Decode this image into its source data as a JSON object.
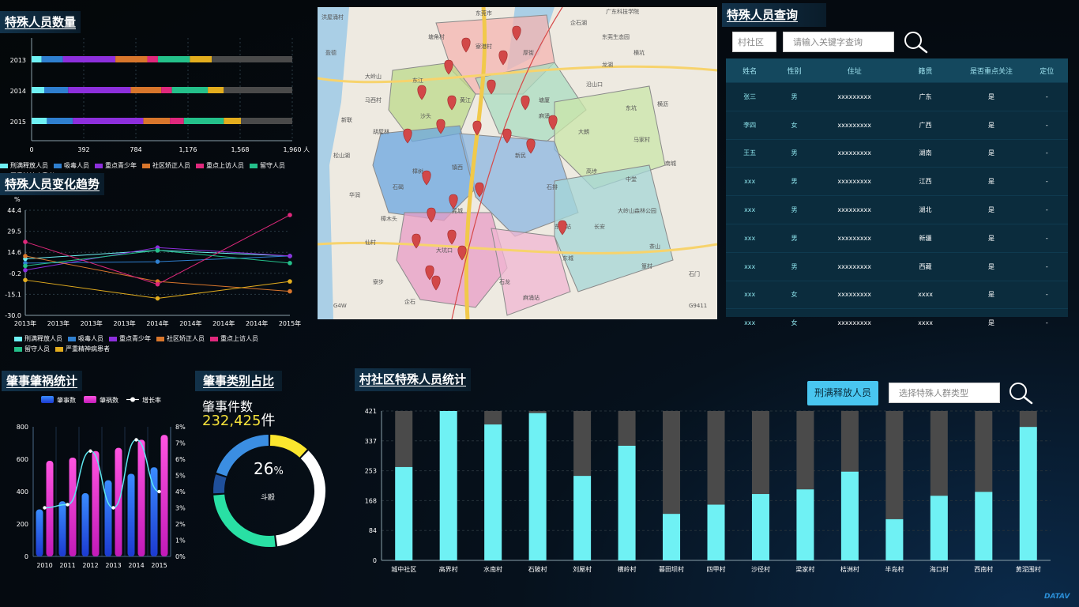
{
  "titles": {
    "count": "特殊人员数量",
    "trend": "特殊人员变化趋势",
    "query": "特殊人员查询",
    "accident": "肇事肇祸统计",
    "category": "肇事类别占比",
    "community": "村社区特殊人员统计"
  },
  "colors": {
    "cyan": "#6ff1f4",
    "blue": "#2f7fcf",
    "purple": "#8d2fdc",
    "orange": "#d8762c",
    "magenta": "#e0287c",
    "green": "#24c08a",
    "yellow": "#e3ad1e",
    "gray": "#4a4a4a"
  },
  "count_chart": {
    "categories": [
      "2013",
      "2014",
      "2015"
    ],
    "xticks": [
      "0",
      "392",
      "784",
      "1,176",
      "1,568",
      "1,960"
    ],
    "xunit": "人",
    "xlim": [
      0,
      1960
    ],
    "series": [
      {
        "name": "刑满释放人员",
        "values": [
          75,
          95,
          115
        ]
      },
      {
        "name": "吸毒人员",
        "values": [
          160,
          180,
          195
        ]
      },
      {
        "name": "重点青少年",
        "values": [
          395,
          470,
          530
        ]
      },
      {
        "name": "社区矫正人员",
        "values": [
          240,
          230,
          200
        ]
      },
      {
        "name": "重点上访人员",
        "values": [
          80,
          80,
          105
        ]
      },
      {
        "name": "留守人员",
        "values": [
          240,
          270,
          300
        ]
      },
      {
        "name": "严重精神病患者",
        "values": [
          165,
          120,
          130
        ]
      }
    ]
  },
  "trend_chart": {
    "unit": "%",
    "yticks": [
      "44.4",
      "29.5",
      "14.6",
      "-0.2",
      "-15.1",
      "-30.0"
    ],
    "ylim": [
      -30,
      44.4
    ],
    "xticks": [
      "2013年",
      "2013年",
      "2013年",
      "2013年",
      "2014年",
      "2014年",
      "2014年",
      "2014年",
      "2015年"
    ],
    "series": [
      {
        "name": "刑满释放人员",
        "points": [
          [
            0,
            10
          ],
          [
            4,
            16
          ],
          [
            8,
            12
          ]
        ]
      },
      {
        "name": "吸毒人员",
        "points": [
          [
            0,
            7
          ],
          [
            4,
            8
          ],
          [
            8,
            12
          ]
        ]
      },
      {
        "name": "重点青少年",
        "points": [
          [
            0,
            2
          ],
          [
            4,
            18
          ],
          [
            8,
            12
          ]
        ]
      },
      {
        "name": "社区矫正人员",
        "points": [
          [
            0,
            12
          ],
          [
            4,
            -6
          ],
          [
            8,
            -13
          ]
        ]
      },
      {
        "name": "重点上访人员",
        "points": [
          [
            0,
            22
          ],
          [
            4,
            -8
          ],
          [
            8,
            41
          ]
        ]
      },
      {
        "name": "留守人员",
        "points": [
          [
            0,
            5
          ],
          [
            4,
            16
          ],
          [
            8,
            7
          ]
        ]
      },
      {
        "name": "严重精神病患者",
        "points": [
          [
            0,
            -5
          ],
          [
            4,
            -18
          ],
          [
            8,
            -6
          ]
        ]
      }
    ]
  },
  "query": {
    "village_placeholder": "村社区",
    "keyword_placeholder": "请输入关键字查询",
    "columns": [
      "姓名",
      "性别",
      "住址",
      "籍贯",
      "是否重点关注",
      "定位"
    ],
    "rows": [
      [
        "张三",
        "男",
        "xxxxxxxxx",
        "广东",
        "是",
        "-"
      ],
      [
        "李四",
        "女",
        "xxxxxxxxx",
        "广西",
        "是",
        "-"
      ],
      [
        "王五",
        "男",
        "xxxxxxxxx",
        "湖南",
        "是",
        "-"
      ],
      [
        "xxx",
        "男",
        "xxxxxxxxx",
        "江西",
        "是",
        "-"
      ],
      [
        "xxx",
        "男",
        "xxxxxxxxx",
        "湖北",
        "是",
        "-"
      ],
      [
        "xxx",
        "男",
        "xxxxxxxxx",
        "新疆",
        "是",
        "-"
      ],
      [
        "xxx",
        "男",
        "xxxxxxxxx",
        "西藏",
        "是",
        "-"
      ],
      [
        "xxx",
        "女",
        "xxxxxxxxx",
        "xxxx",
        "是",
        "-"
      ],
      [
        "xxx",
        "女",
        "xxxxxxxxx",
        "xxxx",
        "是",
        "-"
      ]
    ]
  },
  "map": {
    "labels": [
      "洪屋涌村",
      "东莞市",
      "广东科技学院",
      "东莞生态园",
      "企石湖",
      "龙湖",
      "寮港村",
      "沿山口",
      "东坑",
      "横沥",
      "新民",
      "马家村",
      "盈德",
      "东江",
      "马西村",
      "新联",
      "胡屋林",
      "沙头",
      "麻涌",
      "高埗",
      "中堂",
      "石碣",
      "华润",
      "石排",
      "大岭山森林公园",
      "篁村",
      "莞城",
      "樟木头",
      "仙村",
      "大坑口",
      "石龙",
      "东城",
      "寮步",
      "企石",
      "麻涌站",
      "茶山",
      "石门",
      "松山湖",
      "镇西",
      "塘厦",
      "南城",
      "东城站",
      "长安",
      "樟树",
      "黄江",
      "大朗",
      "厚街",
      "横坑",
      "大岭山",
      "塘角村",
      "G9411",
      "G4W"
    ],
    "pins": 24
  },
  "accident": {
    "legend": [
      "肇事数",
      "肇祸数",
      "增长率"
    ],
    "years": [
      "2010",
      "2011",
      "2012",
      "2013",
      "2014",
      "2015"
    ],
    "incidents": [
      290,
      340,
      390,
      470,
      510,
      550
    ],
    "disasters": [
      590,
      610,
      650,
      670,
      720,
      750
    ],
    "growth_pct": [
      3.0,
      3.2,
      6.5,
      3.0,
      7.2,
      4.0
    ],
    "ylim": [
      0,
      800
    ],
    "y2lim_pct": [
      0,
      8
    ],
    "yticks": [
      "800",
      "600",
      "400",
      "200",
      "0"
    ],
    "y2ticks": [
      "8%",
      "7%",
      "6%",
      "5%",
      "4%",
      "3%",
      "2%",
      "1%",
      "0%"
    ]
  },
  "category": {
    "label": "肇事件数",
    "count": "232,425",
    "count_unit": "件",
    "percent": "26",
    "percent_sign": "%",
    "center_label": "斗殴",
    "segments": [
      {
        "name": "yellow",
        "value": 12,
        "color": "#fbe62e"
      },
      {
        "name": "white",
        "value": 36,
        "color": "#ffffff"
      },
      {
        "name": "green",
        "value": 26,
        "color": "#29e0a4"
      },
      {
        "name": "darkblue",
        "value": 6,
        "color": "#1f4f9a"
      },
      {
        "name": "blue",
        "value": 20,
        "color": "#3b8ee2"
      }
    ]
  },
  "community": {
    "type_button": "刑满释放人员",
    "type_placeholder": "选择特殊人群类型",
    "yticks": [
      "421",
      "337",
      "253",
      "168",
      "84",
      "0"
    ],
    "ylim": [
      0,
      421
    ],
    "categories": [
      "城中社区",
      "高界村",
      "水南村",
      "石陂村",
      "刘屋村",
      "横岭村",
      "暮田坝村",
      "四甲村",
      "沙径村",
      "梁家村",
      "桔洲村",
      "半岛村",
      "海口村",
      "西南村",
      "黄泥围村"
    ],
    "values": [
      263,
      421,
      383,
      415,
      238,
      323,
      131,
      157,
      187,
      200,
      250,
      116,
      182,
      193,
      376
    ],
    "total": 421
  },
  "watermark": "DATAV"
}
